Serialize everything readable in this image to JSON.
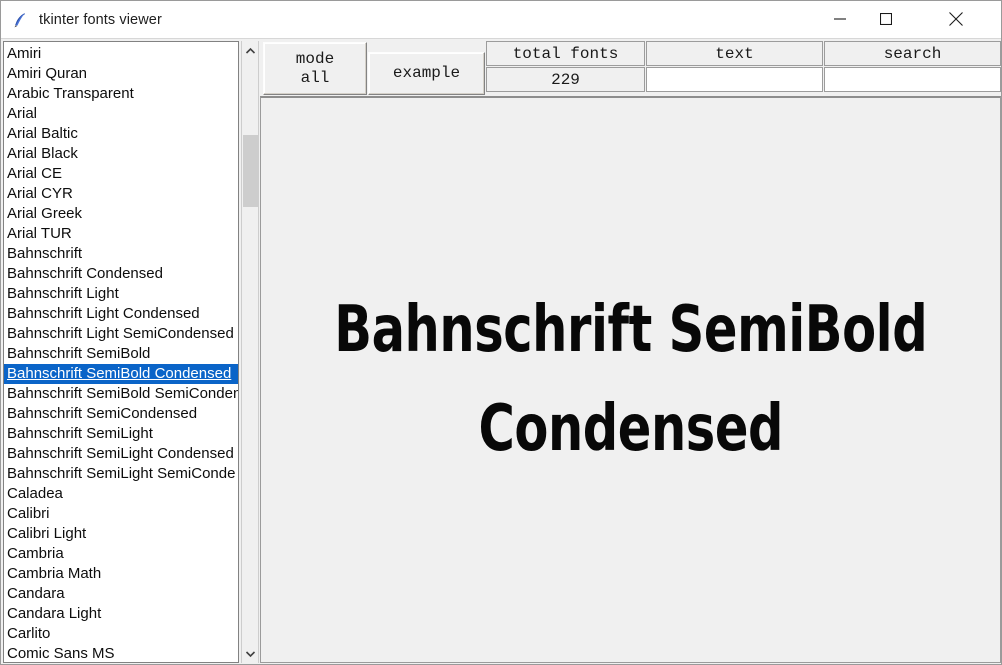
{
  "window": {
    "title": "tkinter fonts viewer",
    "icon": "feather-icon",
    "controls": {
      "minimize": "minimize-icon",
      "maximize": "maximize-icon",
      "close": "close-icon"
    }
  },
  "toolbar": {
    "mode_button": "mode\nall",
    "example_button": "example",
    "total_fonts_label": "total fonts",
    "total_fonts_value": "229",
    "text_label": "text",
    "text_value": "",
    "search_label": "search",
    "search_value": ""
  },
  "preview": {
    "sample_text": "Bahnschrift SemiBold\nCondensed"
  },
  "scrollbar": {
    "up_arrow": "chevron-up-icon",
    "down_arrow": "chevron-down-icon"
  },
  "colors": {
    "selection_blue": "#0a64c8",
    "window_bg": "#f0f0f0",
    "list_bg": "#ffffff",
    "thumb": "#cdcdcd"
  },
  "font_list": {
    "selected_index": 16,
    "items": [
      "Amiri",
      "Amiri Quran",
      "Arabic Transparent",
      "Arial",
      "Arial Baltic",
      "Arial Black",
      "Arial CE",
      "Arial CYR",
      "Arial Greek",
      "Arial TUR",
      "Bahnschrift",
      "Bahnschrift Condensed",
      "Bahnschrift Light",
      "Bahnschrift Light Condensed",
      "Bahnschrift Light SemiCondensed",
      "Bahnschrift SemiBold",
      "Bahnschrift SemiBold Condensed",
      "Bahnschrift SemiBold SemiConden",
      "Bahnschrift SemiCondensed",
      "Bahnschrift SemiLight",
      "Bahnschrift SemiLight Condensed",
      "Bahnschrift SemiLight SemiConde",
      "Caladea",
      "Calibri",
      "Calibri Light",
      "Cambria",
      "Cambria Math",
      "Candara",
      "Candara Light",
      "Carlito",
      "Comic Sans MS"
    ]
  }
}
